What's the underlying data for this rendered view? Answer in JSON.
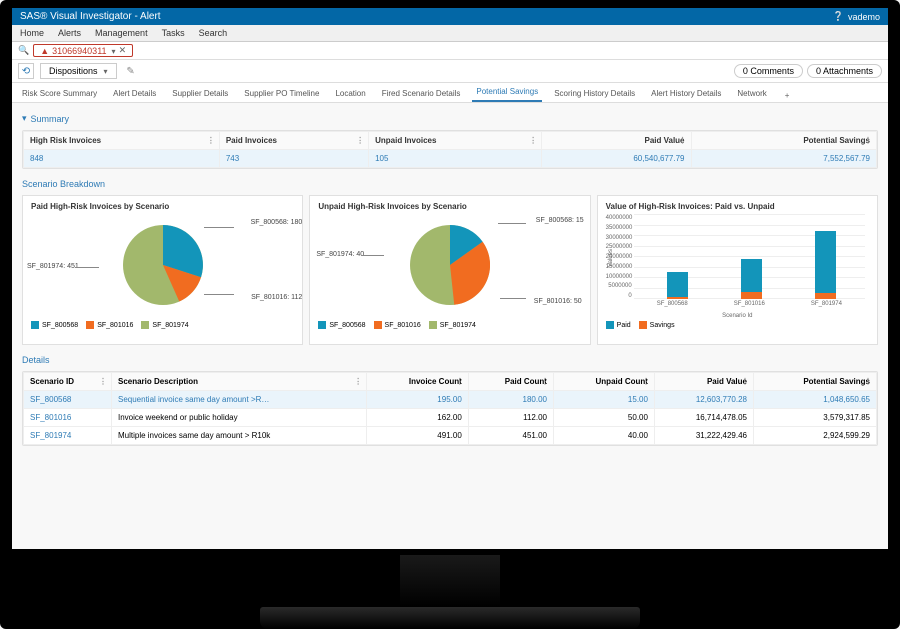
{
  "app_title": "SAS® Visual Investigator - Alert",
  "user": {
    "label": "vademo",
    "icon": "help"
  },
  "menu": [
    "Home",
    "Alerts",
    "Management",
    "Tasks",
    "Search"
  ],
  "breadcrumb": {
    "alert_id": "31066940311",
    "close_title": "Close"
  },
  "toolbar": {
    "dispositions_label": "Dispositions",
    "comments_btn": "0 Comments",
    "attachments_btn": "0 Attachments"
  },
  "tabs": [
    "Risk Score Summary",
    "Alert Details",
    "Supplier Details",
    "Supplier PO Timeline",
    "Location",
    "Fired Scenario Details",
    "Potential Savings",
    "Scoring History Details",
    "Alert History Details",
    "Network"
  ],
  "active_tab_index": 6,
  "summary": {
    "title": "Summary",
    "cols": [
      "High Risk Invoices",
      "Paid Invoices",
      "Unpaid Invoices",
      "Paid Value",
      "Potential Savings"
    ],
    "row": [
      "848",
      "743",
      "105",
      "60,540,677.79",
      "7,552,567.79"
    ]
  },
  "breakdown": {
    "title": "Scenario Breakdown",
    "pie1_title": "Paid High-Risk Invoices by Scenario",
    "pie2_title": "Unpaid High-Risk Invoices by Scenario",
    "bar_title": "Value of High-Risk Invoices: Paid vs. Unpaid",
    "legend_pie": [
      "SF_800568",
      "SF_801016",
      "SF_801974"
    ],
    "legend_bar": [
      "Paid",
      "Savings"
    ],
    "ylabel": "Values",
    "xlabel": "Scenario Id",
    "pie1_labels": {
      "a": "SF_800568: 180",
      "b": "SF_801016: 112",
      "c": "SF_801974: 451"
    },
    "pie2_labels": {
      "a": "SF_800568: 15",
      "b": "SF_801016: 50",
      "c": "SF_801974: 40"
    }
  },
  "details": {
    "title": "Details",
    "cols": [
      "Scenario ID",
      "Scenario Description",
      "Invoice Count",
      "Paid Count",
      "Unpaid Count",
      "Paid Value",
      "Potential Savings"
    ],
    "rows": [
      [
        "SF_800568",
        "Sequential invoice same day amount >R…",
        "195.00",
        "180.00",
        "15.00",
        "12,603,770.28",
        "1,048,650.65"
      ],
      [
        "SF_801016",
        "Invoice weekend or public holiday",
        "162.00",
        "112.00",
        "50.00",
        "16,714,478.05",
        "3,579,317.85"
      ],
      [
        "SF_801974",
        "Multiple invoices same day amount > R10k",
        "491.00",
        "451.00",
        "40.00",
        "31,222,429.46",
        "2,924,599.29"
      ]
    ]
  },
  "chart_data": [
    {
      "type": "pie",
      "title": "Paid High-Risk Invoices by Scenario",
      "categories": [
        "SF_800568",
        "SF_801016",
        "SF_801974"
      ],
      "values": [
        180,
        112,
        451
      ]
    },
    {
      "type": "pie",
      "title": "Unpaid High-Risk Invoices by Scenario",
      "categories": [
        "SF_800568",
        "SF_801016",
        "SF_801974"
      ],
      "values": [
        15,
        50,
        40
      ]
    },
    {
      "type": "bar",
      "title": "Value of High-Risk Invoices: Paid vs. Unpaid",
      "categories": [
        "SF_800568",
        "SF_801016",
        "SF_801974"
      ],
      "series": [
        {
          "name": "Paid",
          "values": [
            12603770,
            16714478,
            31222429
          ]
        },
        {
          "name": "Savings",
          "values": [
            1048651,
            3579318,
            2924599
          ]
        }
      ],
      "ylabel": "Values",
      "xlabel": "Scenario Id",
      "ylim": [
        0,
        40000000
      ],
      "yticks": [
        0,
        5000000,
        10000000,
        15000000,
        20000000,
        25000000,
        30000000,
        35000000,
        40000000
      ]
    }
  ]
}
